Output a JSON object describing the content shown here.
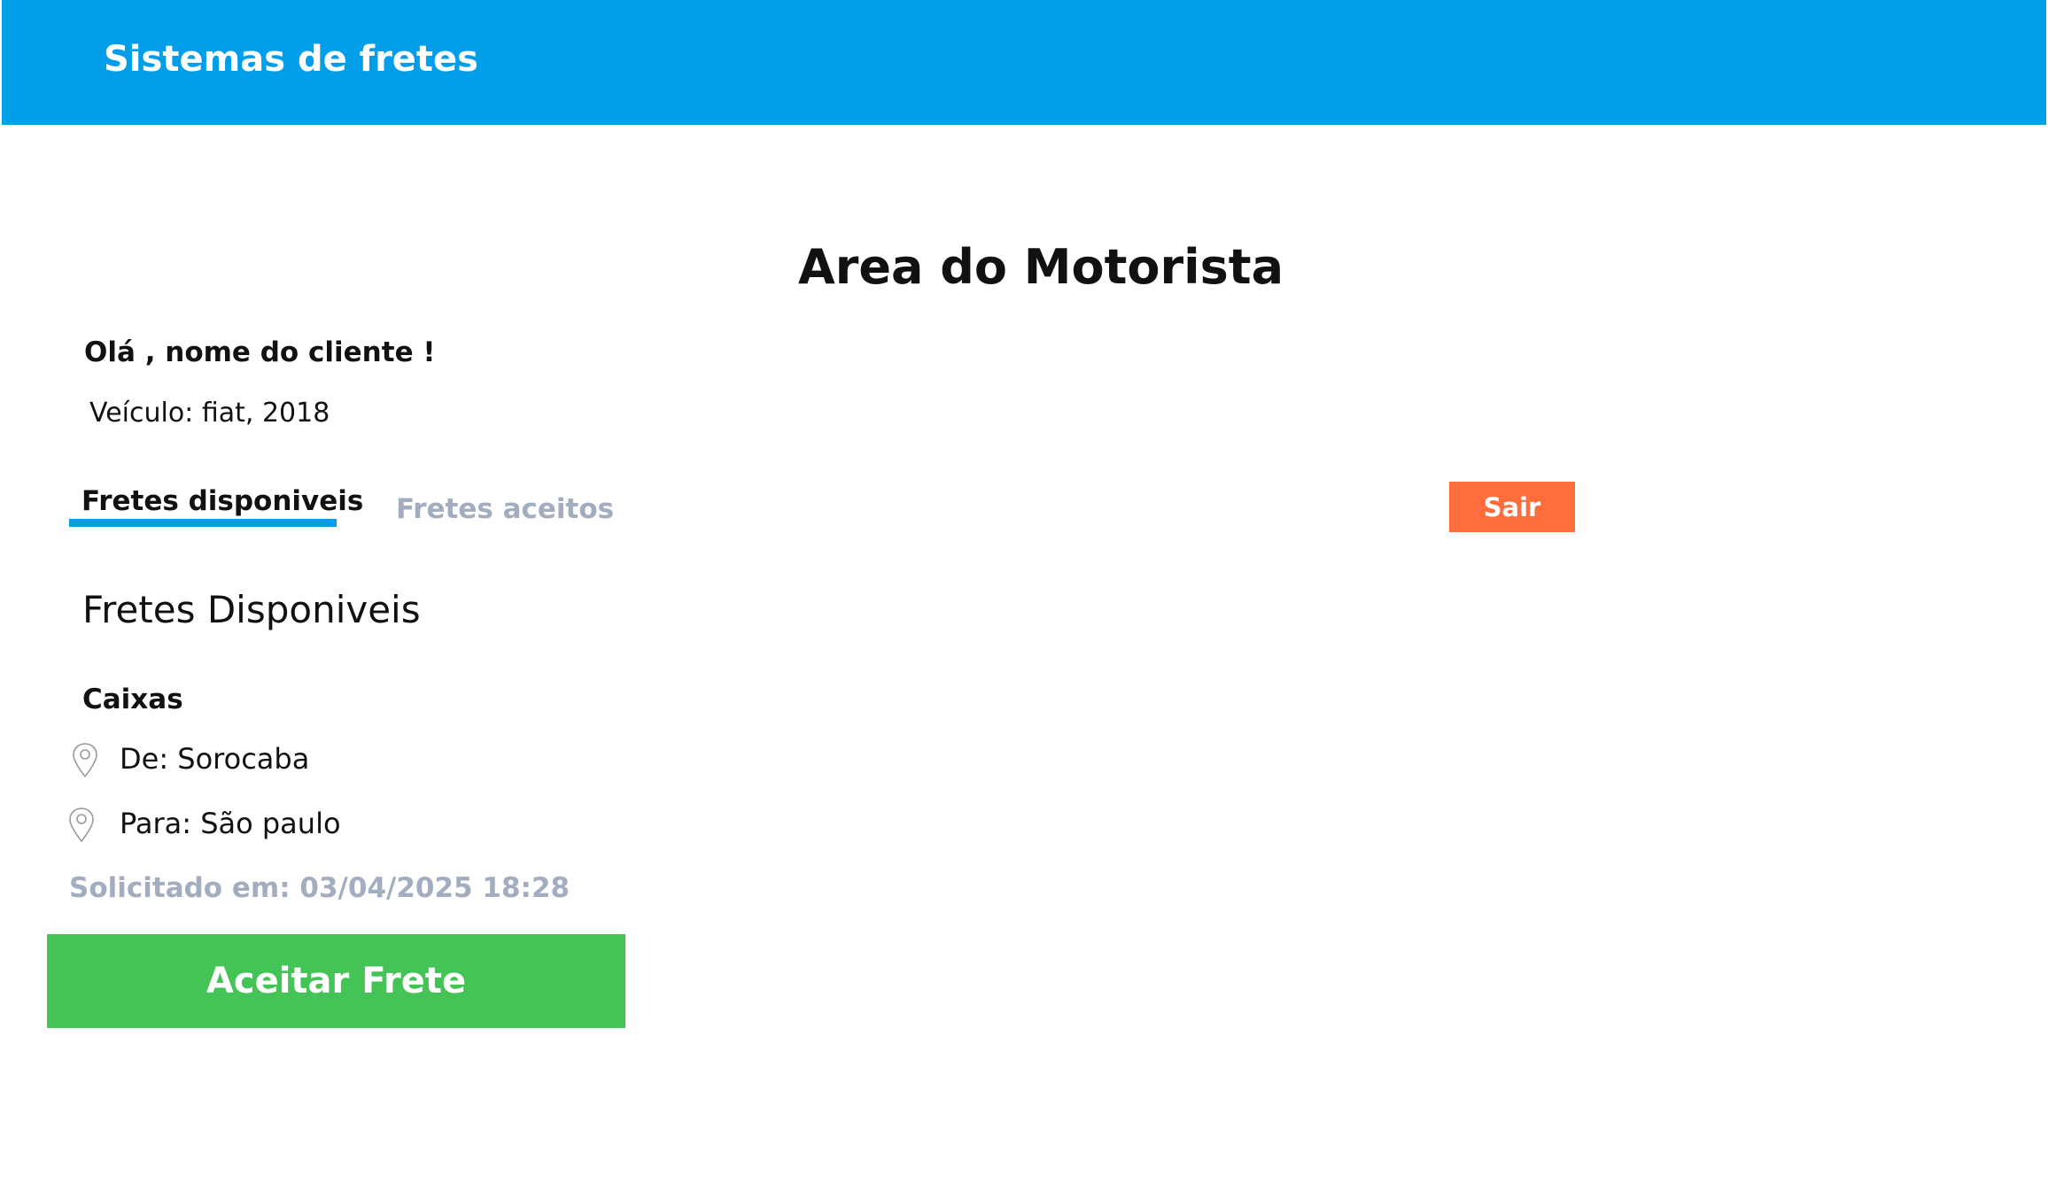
{
  "header": {
    "app_title": "Sistemas de fretes"
  },
  "main": {
    "page_title": "Area do Motorista",
    "greeting": "Olá , nome do cliente !",
    "vehicle": "Veículo: fiat, 2018",
    "tabs": [
      {
        "label": "Fretes disponiveis",
        "active": true
      },
      {
        "label": "Fretes aceitos",
        "active": false
      }
    ],
    "logout_label": "Sair",
    "section_title": "Fretes Disponiveis",
    "freights": [
      {
        "cargo": "Caixas",
        "from": "De: Sorocaba",
        "to": "Para: São paulo",
        "requested": "Solicitado em: 03/04/2025 18:28",
        "accept_label": "Aceitar Frete"
      }
    ]
  },
  "colors": {
    "header_bg": "#039ee9",
    "tab_underline": "#039ee9",
    "logout_bg": "#ff6d3d",
    "accept_bg": "#44c456",
    "muted_text": "#a3adc0"
  },
  "icons": [
    "map-pin-icon"
  ]
}
